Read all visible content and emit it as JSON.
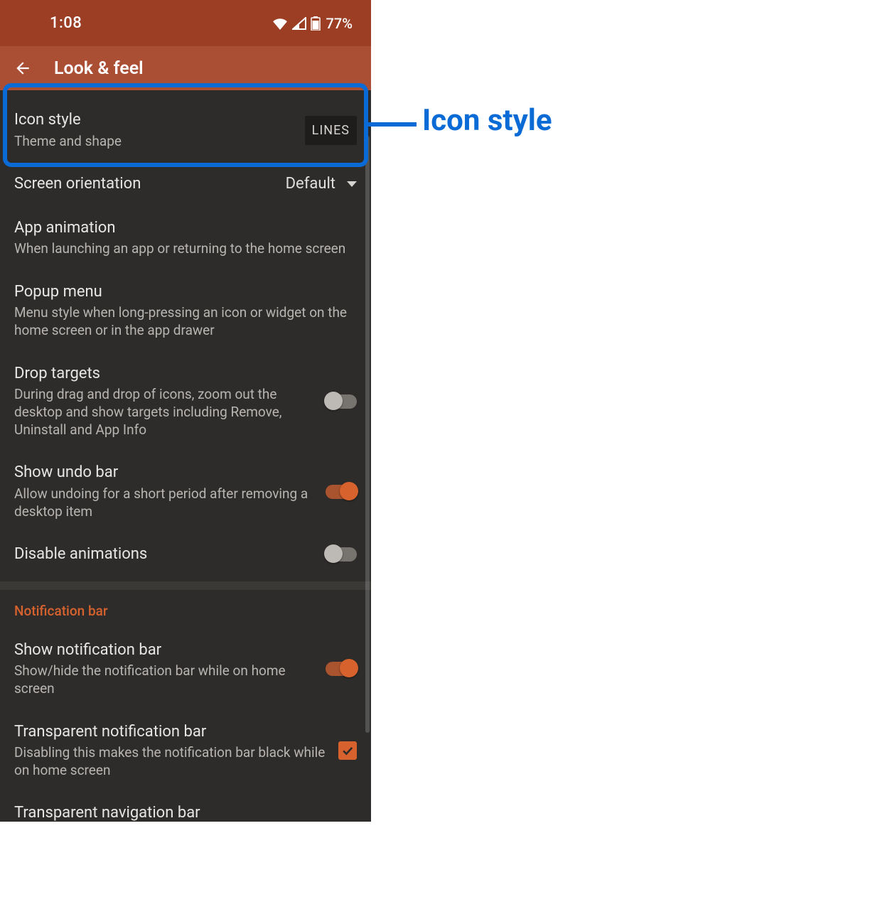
{
  "statusbar": {
    "time": "1:08",
    "battery": "77%"
  },
  "appbar": {
    "title": "Look & feel"
  },
  "rows": {
    "icon_style": {
      "title": "Icon style",
      "sub": "Theme and shape",
      "chip": "LINES"
    },
    "screen_orientation": {
      "title": "Screen orientation",
      "value": "Default"
    },
    "app_animation": {
      "title": "App animation",
      "sub": "When launching an app or returning to the home screen"
    },
    "popup_menu": {
      "title": "Popup menu",
      "sub": "Menu style when long-pressing an icon or widget on the home screen or in the app drawer"
    },
    "drop_targets": {
      "title": "Drop targets",
      "sub": "During drag and drop of icons, zoom out the desktop and show targets including Remove, Uninstall and App Info"
    },
    "show_undo": {
      "title": "Show undo bar",
      "sub": "Allow undoing for a short period after removing a desktop item"
    },
    "disable_anim": {
      "title": "Disable animations"
    },
    "show_notif": {
      "title": "Show notification bar",
      "sub": "Show/hide the notification bar while on home screen"
    },
    "trans_notif": {
      "title": "Transparent notification bar",
      "sub": "Disabling this makes the notification bar black while on home screen"
    },
    "trans_nav": {
      "title": "Transparent navigation bar"
    }
  },
  "section": {
    "notification_bar": "Notification bar"
  },
  "callout": {
    "label": "Icon style"
  }
}
